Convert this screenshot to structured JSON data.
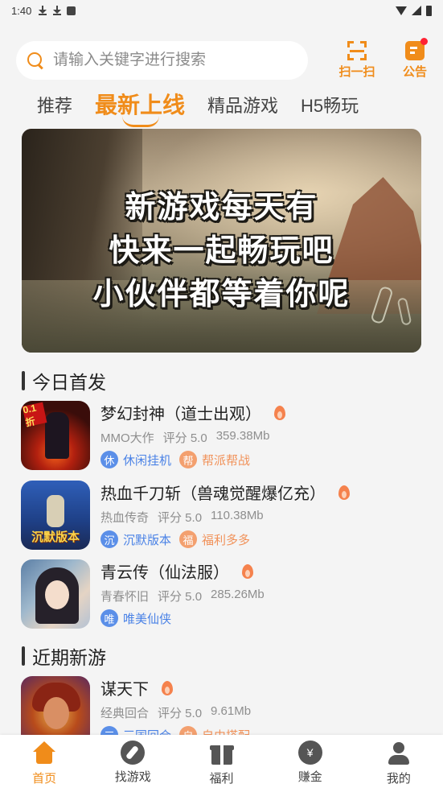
{
  "status_bar": {
    "time": "1:40"
  },
  "search": {
    "placeholder": "请输入关键字进行搜索"
  },
  "top_actions": {
    "scan_label": "扫一扫",
    "notice_label": "公告"
  },
  "tabs": [
    {
      "label": "推荐",
      "active": false
    },
    {
      "label": "最新上线",
      "active": true
    },
    {
      "label": "精品游戏",
      "active": false
    },
    {
      "label": "H5畅玩",
      "active": false
    }
  ],
  "banner": {
    "lines": [
      "新游戏每天有",
      "快来一起畅玩吧",
      "小伙伴都等着你呢"
    ]
  },
  "sections": {
    "today": {
      "title": "今日首发",
      "games": [
        {
          "name": "梦幻封神（道士出观）",
          "category": "MMO大作",
          "rating": "评分 5.0",
          "size": "359.38Mb",
          "cover_label": "0.1折",
          "tags": [
            {
              "badge": "休",
              "text": "休闲挂机",
              "color": "blue"
            },
            {
              "badge": "帮",
              "text": "帮派帮战",
              "color": "orange"
            }
          ]
        },
        {
          "name": "热血千刀斩（兽魂觉醒爆亿充）",
          "category": "热血传奇",
          "rating": "评分 5.0",
          "size": "110.38Mb",
          "cover_label": "沉默版本",
          "tags": [
            {
              "badge": "沉",
              "text": "沉默版本",
              "color": "blue"
            },
            {
              "badge": "福",
              "text": "福利多多",
              "color": "orange"
            }
          ]
        },
        {
          "name": "青云传（仙法服）",
          "category": "青春怀旧",
          "rating": "评分 5.0",
          "size": "285.26Mb",
          "tags": [
            {
              "badge": "唯",
              "text": "唯美仙侠",
              "color": "blue"
            }
          ]
        }
      ]
    },
    "recent": {
      "title": "近期新游",
      "games": [
        {
          "name": "谋天下",
          "category": "经典回合",
          "rating": "评分 5.0",
          "size": "9.61Mb",
          "tags": [
            {
              "badge": "三",
              "text": "三国回合",
              "color": "blue"
            },
            {
              "badge": "自",
              "text": "自由搭配",
              "color": "orange"
            }
          ]
        }
      ]
    }
  },
  "bottom_nav": [
    {
      "label": "首页",
      "icon": "home-icon",
      "active": true
    },
    {
      "label": "找游戏",
      "icon": "compass-icon",
      "active": false
    },
    {
      "label": "福利",
      "icon": "gift-icon",
      "active": false
    },
    {
      "label": "赚金",
      "icon": "money-icon",
      "active": false
    },
    {
      "label": "我的",
      "icon": "user-icon",
      "active": false
    }
  ],
  "colors": {
    "accent": "#f08c1a",
    "tag_blue": "#5b8fe8",
    "tag_orange": "#f3a06f"
  }
}
